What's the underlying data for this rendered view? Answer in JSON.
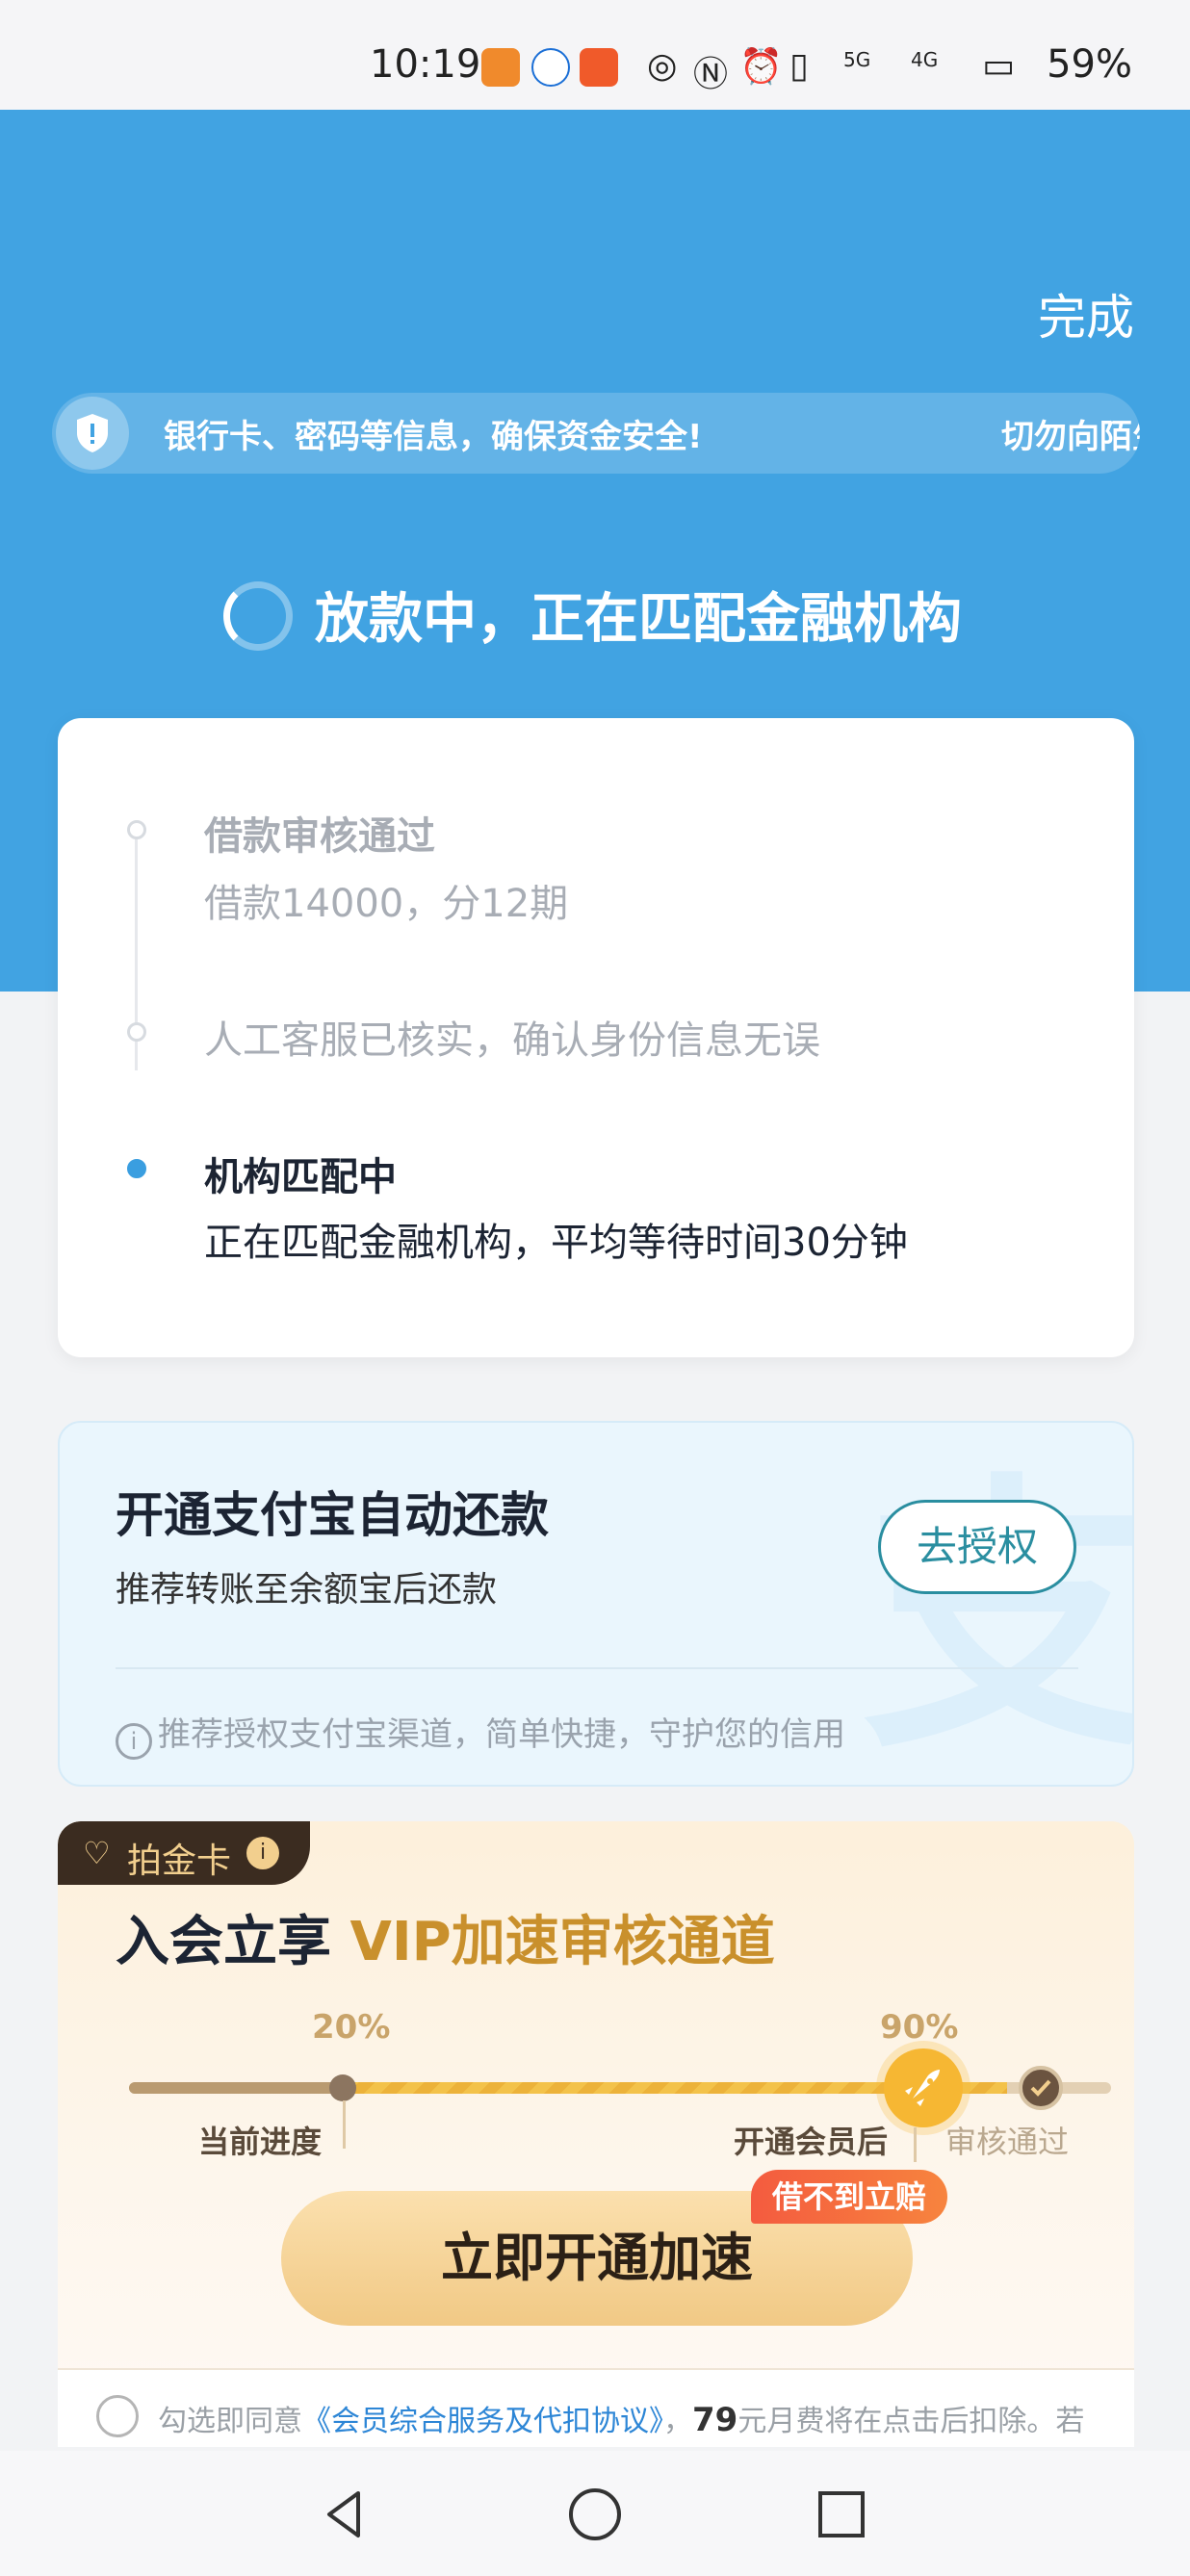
{
  "status_bar": {
    "time": "10:19",
    "network1": "5G",
    "network2": "4G",
    "battery": "59%"
  },
  "header": {
    "done_label": "完成",
    "notice_text": "银行卡、密码等信息，确保资金安全!",
    "notice_text_2": "切勿向陌生",
    "status_title": "放款中，正在匹配金融机构"
  },
  "progress": {
    "steps": [
      {
        "title": "借款审核通过",
        "subtitle": "借款14000，分12期"
      },
      {
        "title": "人工客服已核实，确认身份信息无误",
        "subtitle": ""
      },
      {
        "title": "机构匹配中",
        "subtitle": "正在匹配金融机构，平均等待时间30分钟"
      }
    ]
  },
  "alipay": {
    "title": "开通支付宝自动还款",
    "subtitle": "推荐转账至余额宝后还款",
    "button_label": "去授权",
    "tip": "推荐授权支付宝渠道，简单快捷，守护您的信用",
    "bg_glyph": "支"
  },
  "vip": {
    "tab_label": "拍金卡",
    "heading_plain": "入会立享 ",
    "heading_gold": "VIP加速审核通道",
    "current_pct": "20%",
    "member_pct": "90%",
    "current_value": 0.2,
    "member_value": 0.9,
    "label_current": "当前进度",
    "label_member": "开通会员后",
    "label_pass": "审核通过",
    "button_label": "立即开通加速",
    "badge": "借不到立赔"
  },
  "agreement": {
    "prefix": "勾选即同意",
    "link": "《会员综合服务及代扣协议》",
    "mid": "，",
    "amount": "79",
    "suffix": "元月费将在点击后扣除。若"
  },
  "colors": {
    "primary_blue": "#41a3e2",
    "gold": "#c9902c",
    "teal_button": "#2a8ea0"
  }
}
